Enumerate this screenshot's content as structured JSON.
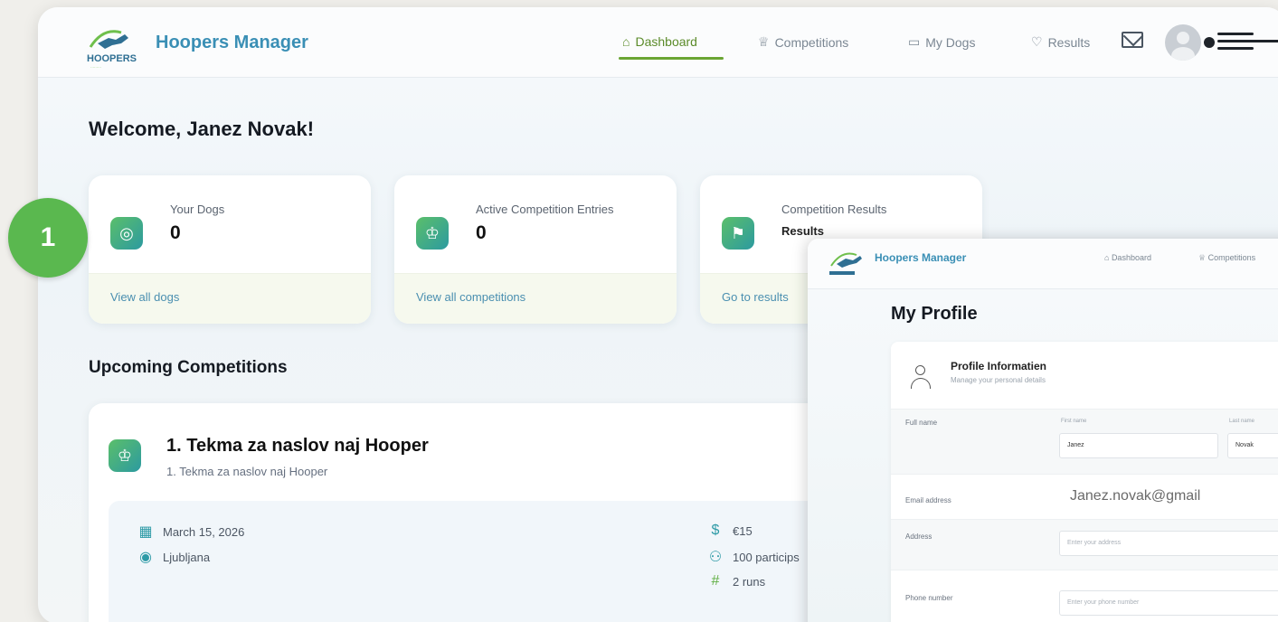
{
  "app": {
    "name": "Hoopers Manager",
    "logo_text": "HOOPERS"
  },
  "nav": {
    "items": [
      {
        "label": "Dashboard",
        "icon": "home-icon",
        "active": true
      },
      {
        "label": "Competitions",
        "icon": "trophy-icon",
        "active": false
      },
      {
        "label": "My Dogs",
        "icon": "dog-icon",
        "active": false
      },
      {
        "label": "Results",
        "icon": "award-icon",
        "active": false
      }
    ]
  },
  "step_marker": "1",
  "welcome": "Welcome, Janez Novak!",
  "stats": [
    {
      "label": "Your Dogs",
      "value": "0",
      "link": "View all dogs",
      "icon": "apple-icon"
    },
    {
      "label": "Active Competition Entries",
      "value": "0",
      "link": "View all competitions",
      "icon": "trophy-icon"
    },
    {
      "label": "Competition Results",
      "value": "Results",
      "link": "Go to results",
      "icon": "medal-icon"
    }
  ],
  "upcoming": {
    "title": "Upcoming Competitions",
    "competition": {
      "title": "1. Tekma za naslov naj Hooper",
      "subtitle": "1. Tekma za naslov naj Hooper",
      "date": "March 15, 2026",
      "location": "Ljubljana",
      "fee": "€15",
      "participants": "100 particips",
      "runs": "2 runs"
    }
  },
  "profile": {
    "header_name": "Hoopers Manager",
    "nav_dashboard": "Dashboard",
    "nav_competitions": "Competitions",
    "title": "My Profile",
    "section_title": "Profile Informatien",
    "section_sub": "Manage your personal details",
    "full_name_label": "Full name",
    "first_name_label": "First name",
    "last_name_label": "Last name",
    "first_name": "Janez",
    "last_name": "Novak",
    "email_label": "Email address",
    "email": "Janez.novak@gmail",
    "address_label": "Address",
    "address_placeholder": "Enter your address",
    "phone_label": "Phone number",
    "phone_placeholder": "Enter your phone number"
  },
  "colors": {
    "accent_green": "#5ab84f",
    "brand_blue": "#3a8fb5",
    "teal": "#2c9aa0"
  }
}
